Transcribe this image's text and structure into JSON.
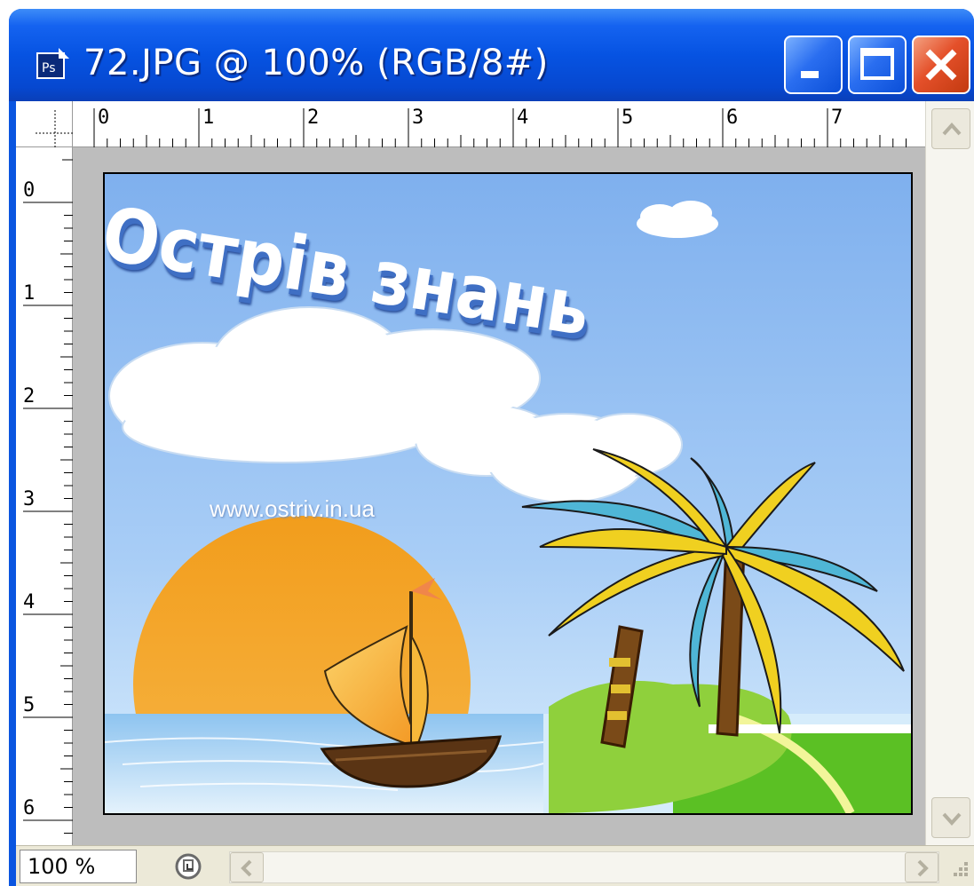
{
  "window": {
    "app_icon_label": "Ps",
    "title": "72.JPG @ 100% (RGB/8#)"
  },
  "rulers": {
    "horizontal": [
      "0",
      "1",
      "2",
      "3",
      "4",
      "5",
      "6",
      "7"
    ],
    "vertical": [
      "0",
      "1",
      "2",
      "3",
      "4",
      "5",
      "6"
    ]
  },
  "artwork": {
    "title": "Острів знань",
    "url": "www.ostriv.in.ua"
  },
  "status": {
    "zoom": "100 %"
  },
  "colors": {
    "titlebar": "#0653e2",
    "close_button": "#e4502a",
    "canvas_background": "#bdbdbd",
    "sky": "#8fbaf2",
    "sun": "#f5a524",
    "sea": "#c8e4f8",
    "island": "#8fd03c",
    "palm_leaf": "#f0d020"
  }
}
